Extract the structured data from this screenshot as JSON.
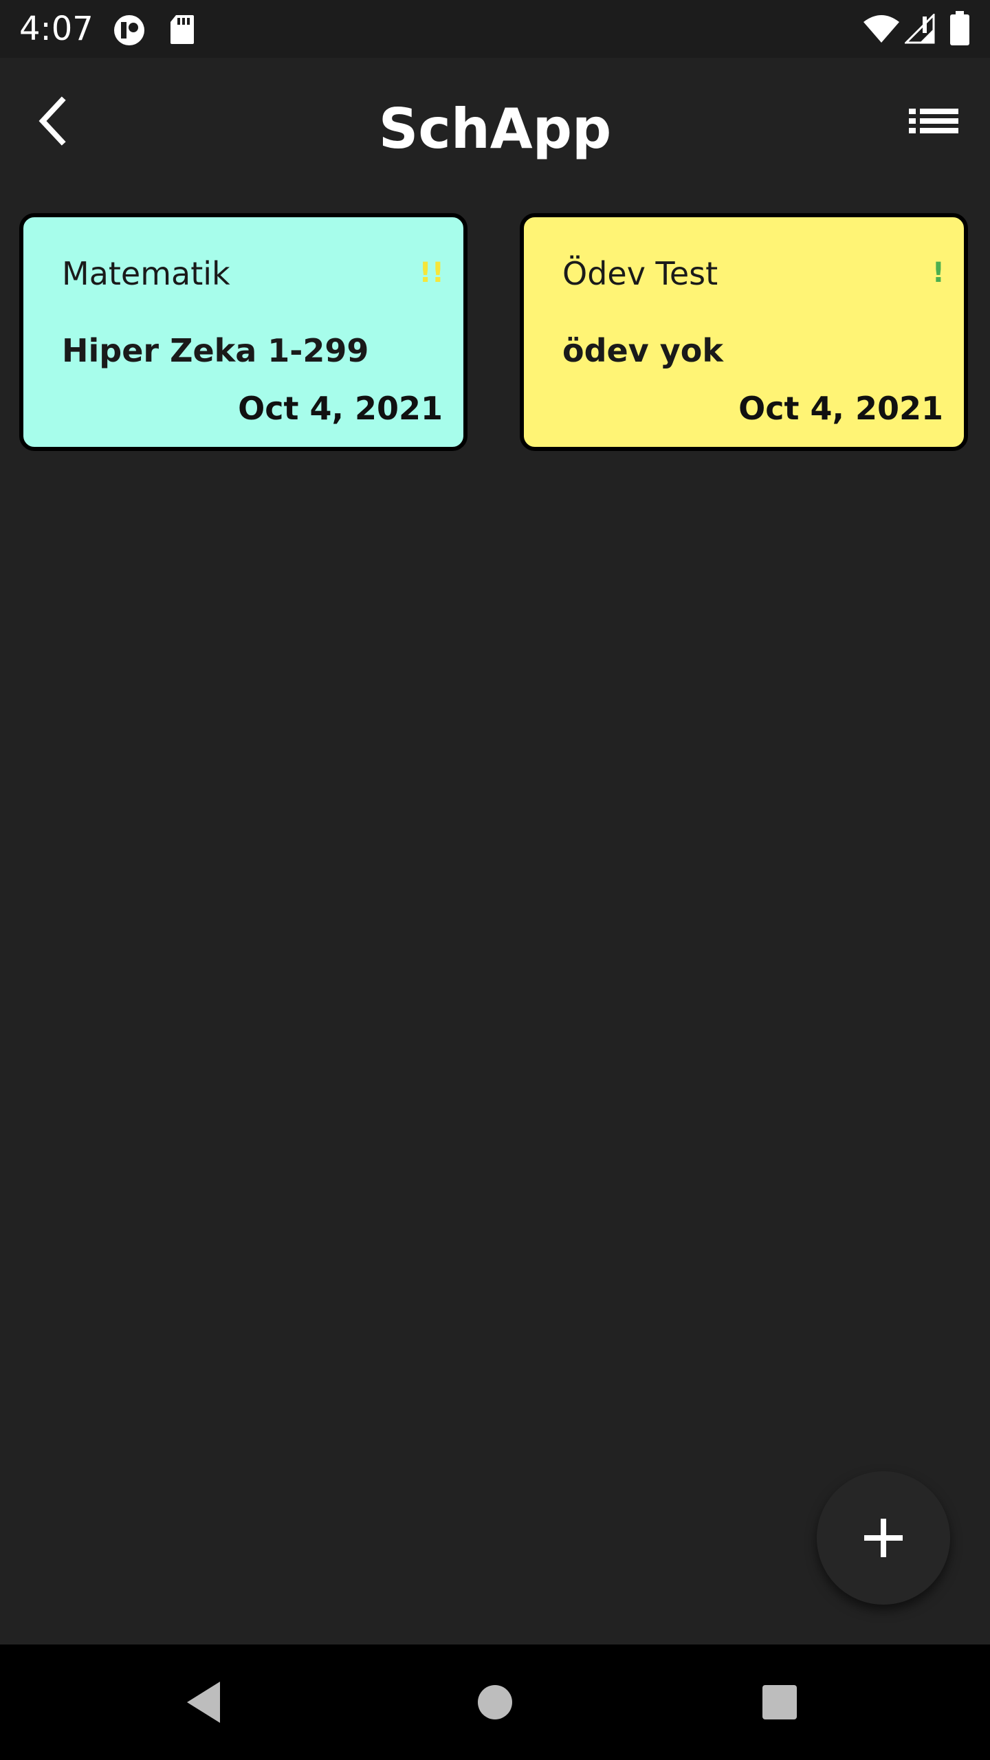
{
  "status_bar": {
    "time": "4:07",
    "icons": [
      "notification-app-icon",
      "sd-card-icon",
      "wifi-icon",
      "cellular-signal-icon",
      "battery-icon"
    ]
  },
  "app_bar": {
    "title": "SchApp",
    "back_icon": "chevron-left-icon",
    "menu_icon": "list-icon"
  },
  "cards": [
    {
      "subject": "Matematik",
      "priority": "!!",
      "priority_color": "#f5e63a",
      "task": "Hiper Zeka 1-299",
      "date": "Oct 4, 2021",
      "background": "#a7fdeb"
    },
    {
      "subject": "Ödev Test",
      "priority": "!",
      "priority_color": "#4caf50",
      "task": "ödev yok",
      "date": "Oct 4, 2021",
      "background": "#fff475"
    }
  ],
  "fab": {
    "icon": "plus-icon"
  },
  "nav_bar": {
    "icons": [
      "back-triangle-icon",
      "home-circle-icon",
      "recents-square-icon"
    ]
  },
  "colors": {
    "background": "#222222",
    "card_border": "#000000"
  }
}
